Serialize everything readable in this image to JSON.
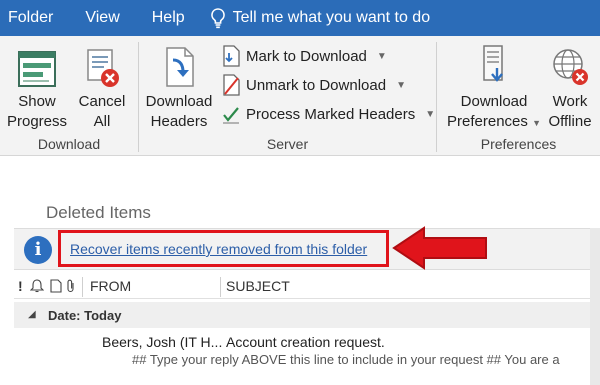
{
  "menu": {
    "items": [
      "Folder",
      "View",
      "Help"
    ],
    "tell_me": "Tell me what you want to do"
  },
  "ribbon": {
    "download_group": {
      "title": "Download",
      "show_progress": [
        "Show",
        "Progress"
      ],
      "cancel_all": [
        "Cancel",
        "All"
      ]
    },
    "server_group": {
      "title": "Server",
      "download_headers": [
        "Download",
        "Headers"
      ],
      "mark_to_download": "Mark to Download",
      "unmark_to_download": "Unmark to Download",
      "process_marked_headers": "Process Marked Headers"
    },
    "preferences_group": {
      "title": "Preferences",
      "download_preferences": [
        "Download",
        "Preferences"
      ],
      "work_offline": [
        "Work",
        "Offline"
      ]
    }
  },
  "folder": {
    "title": "Deleted Items",
    "info_link": "Recover items recently removed from this folder"
  },
  "columns": {
    "from": "FROM",
    "subject": "SUBJECT"
  },
  "group_header": "Date: Today",
  "mail_items": [
    {
      "from": "Beers, Josh (IT H...",
      "subject": "Account creation request.",
      "preview": "## Type your reply ABOVE this line to include in your request ##  You are a"
    }
  ],
  "colors": {
    "menubar": "#2b6cb8",
    "highlight": "#e0141b",
    "link": "#2c5ea8"
  }
}
